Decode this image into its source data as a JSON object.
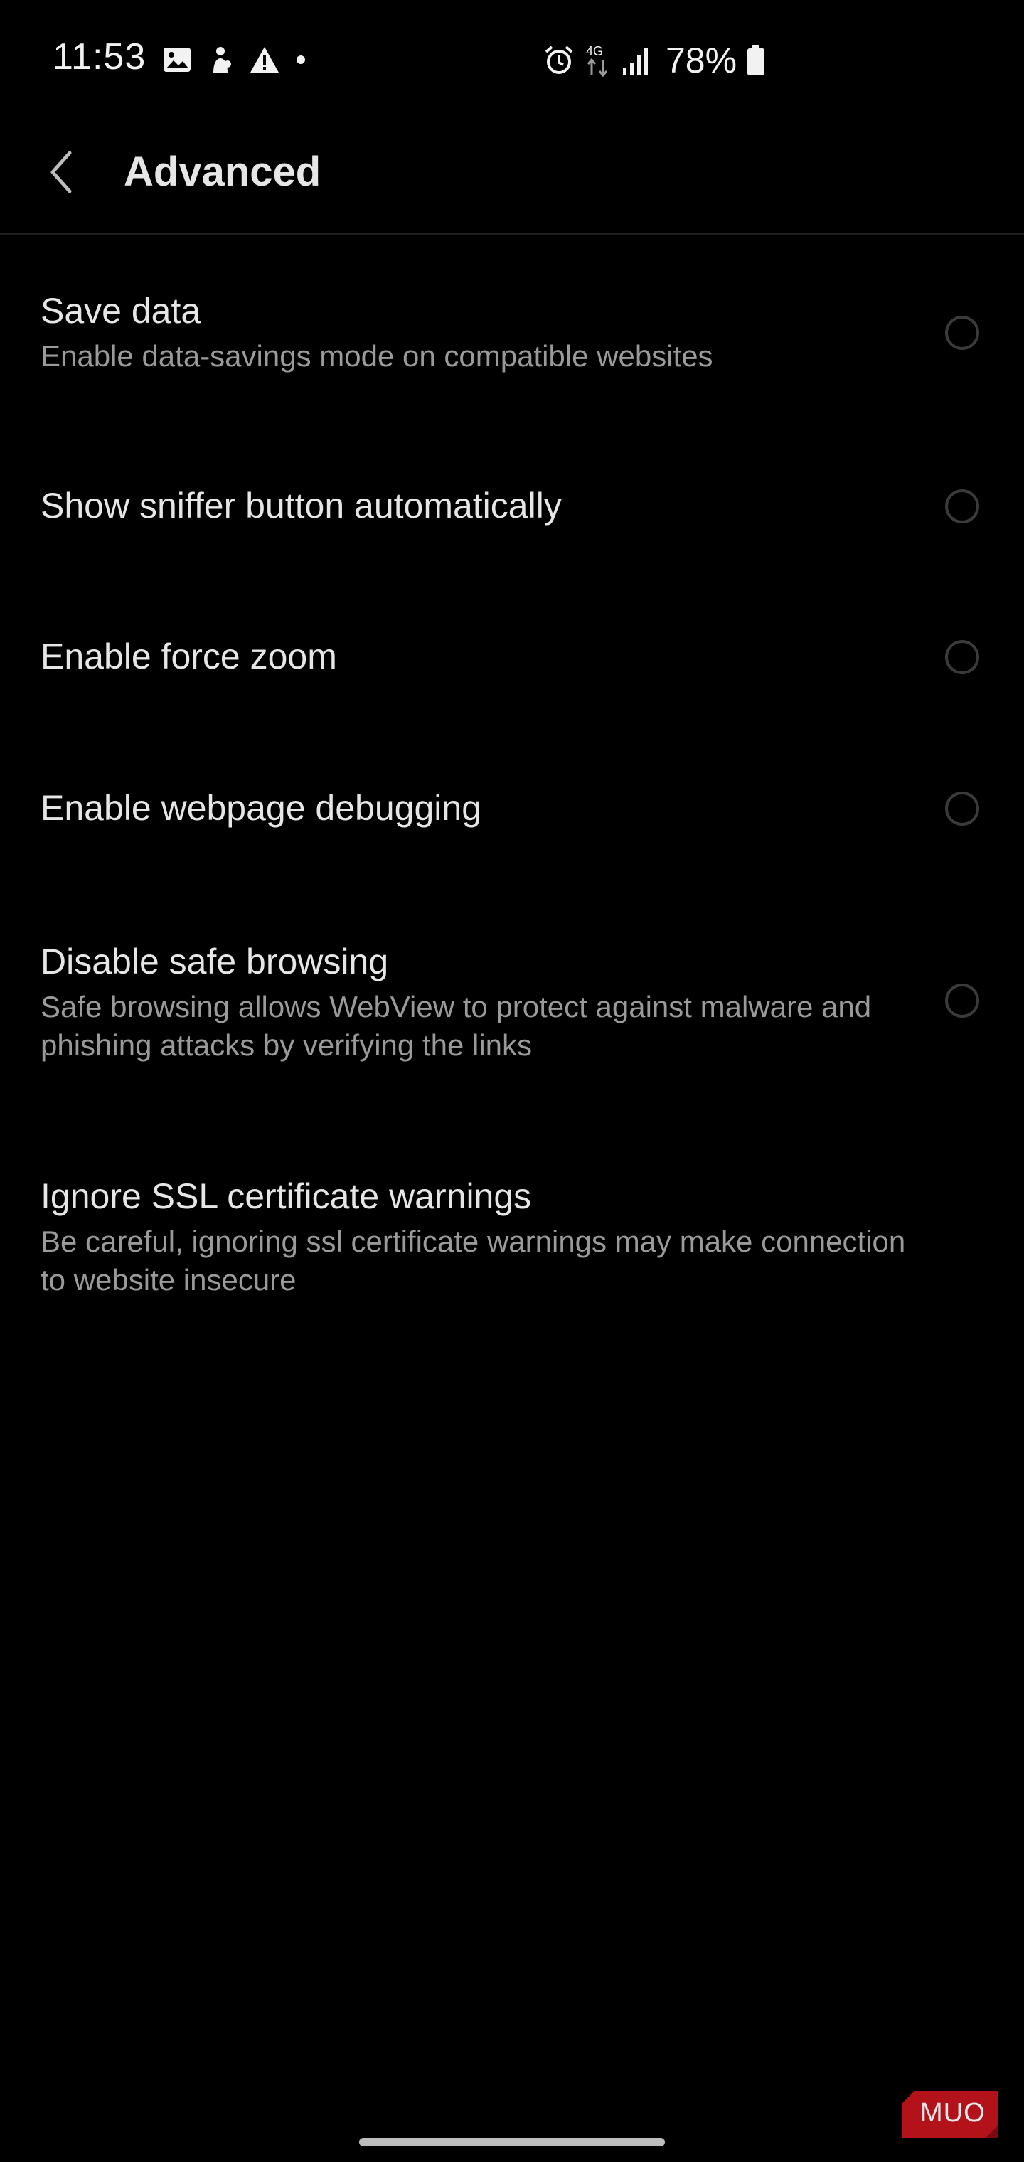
{
  "status_bar": {
    "time": "11:53",
    "battery_percent": "78%",
    "network": "4G",
    "left_icons": [
      "gallery-icon",
      "app-notification-icon",
      "warning-icon",
      "dot-icon"
    ],
    "right_icons": [
      "alarm-icon",
      "4g-data-icon",
      "signal-icon",
      "battery-icon"
    ]
  },
  "header": {
    "title": "Advanced",
    "back_icon": "chevron-left-icon"
  },
  "settings": [
    {
      "title": "Save data",
      "description": "Enable data-savings mode on compatible websites",
      "toggle": "radio",
      "checked": false
    },
    {
      "title": "Show sniffer button automatically",
      "description": "",
      "toggle": "radio",
      "checked": false
    },
    {
      "title": "Enable force zoom",
      "description": "",
      "toggle": "radio",
      "checked": false
    },
    {
      "title": "Enable webpage debugging",
      "description": "",
      "toggle": "radio",
      "checked": false
    },
    {
      "title": "Disable safe browsing",
      "description": "Safe browsing allows WebView to protect against malware and phishing attacks by verifying the links",
      "toggle": "radio",
      "checked": false
    },
    {
      "title": "Ignore SSL certificate warnings",
      "description": "Be careful, ignoring ssl certificate warnings may make connection to website insecure",
      "toggle": "none",
      "checked": false
    }
  ],
  "watermark": {
    "text": "MUO",
    "color": "#b3121b"
  },
  "colors": {
    "background": "#000000",
    "title_text": "#e6e6e6",
    "secondary_text": "#9a9a9a",
    "radio_border": "#3a3a3a"
  }
}
